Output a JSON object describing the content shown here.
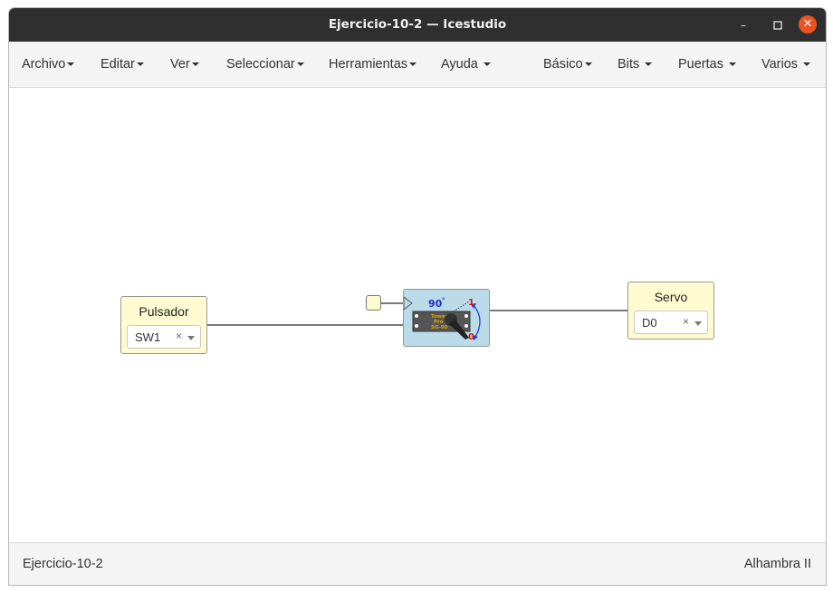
{
  "window": {
    "title": "Ejercicio-10-2 — Icestudio"
  },
  "menubar": {
    "left": [
      "Archivo",
      "Editar",
      "Ver",
      "Seleccionar",
      "Herramientas",
      "Ayuda"
    ],
    "right": [
      "Básico",
      "Bits",
      "Puertas",
      "Varios"
    ]
  },
  "canvas": {
    "input_block": {
      "name": "Pulsador",
      "pin": "SW1",
      "clear": "×"
    },
    "output_block": {
      "name": "Servo",
      "pin": "D0",
      "clear": "×"
    },
    "servo_block": {
      "angle_label": "90",
      "degree_symbol": "°",
      "one_label": "1",
      "zero_label": "0",
      "chip_text": [
        "Tower",
        "Pro",
        "SG-90"
      ]
    }
  },
  "statusbar": {
    "project": "Ejercicio-10-2",
    "board": "Alhambra II"
  },
  "colors": {
    "titlebar": "#2f2f2f",
    "close_button": "#e95420",
    "io_block": "#fffbd0",
    "servo_block": "#bcdbe8"
  }
}
